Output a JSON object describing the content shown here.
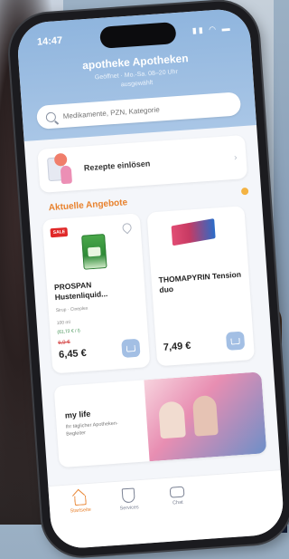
{
  "status_bar": {
    "time": "14:47",
    "signal_icons": "▮▮ ◠ ▬"
  },
  "header": {
    "pharmacy_name": "apotheke Apotheken",
    "hours": "Geöffnet · Mo.-Sa. 08–20 Uhr",
    "status": "ausgewählt"
  },
  "search": {
    "placeholder": "Medikamente, PZN, Kategorie"
  },
  "prescription": {
    "label": "Rezepte einlösen"
  },
  "offers": {
    "title": "Aktuelle Angebote"
  },
  "products": [
    {
      "badge": "SALE",
      "name": "PROSPAN Hustenliquid...",
      "meta": "Sirup · Cineplex",
      "sub": "100 ml",
      "unit": "(61,72 € / l)",
      "old_price": "6,9 €",
      "price": "6,45 €"
    },
    {
      "badge": "",
      "name": "THOMAPYRIN Tension duo",
      "meta": "",
      "sub": "",
      "unit": "",
      "old_price": "",
      "price": "7,49 €"
    }
  ],
  "promo": {
    "title": "my life",
    "subtitle": "Ihr täglicher Apotheken-Begleiter"
  },
  "tabbar": [
    {
      "label": "Startseite",
      "icon": "home-icon",
      "active": true
    },
    {
      "label": "Services",
      "icon": "shield-icon",
      "active": false
    },
    {
      "label": "Chat",
      "icon": "chat-icon",
      "active": false
    }
  ],
  "colors": {
    "accent": "#e8822e",
    "header": "#8fb5de",
    "cart_button": "#a3bfe4",
    "sale": "#e02828"
  }
}
